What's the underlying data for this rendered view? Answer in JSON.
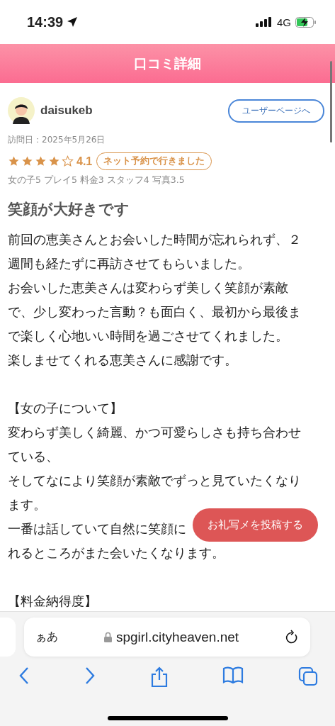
{
  "status_bar": {
    "time": "14:39",
    "network": "4G"
  },
  "header": {
    "title": "口コミ詳細"
  },
  "review": {
    "user": {
      "name": "daisukeb",
      "profile_button": "ユーザーページへ"
    },
    "visit_date": "訪問日：2025年5月26日",
    "stars": 4,
    "score": "4.1",
    "badge": "ネット予約で行きました",
    "sub_ratings": "女の子5 プレイ5 料金3 スタッフ4 写真3.5",
    "title": "笑顔が大好きです",
    "paragraphs": [
      {
        "lines": [
          "前回の恵美さんとお会いした時間が忘れられず、２",
          "週間も経たずに再訪させてもらいました。",
          "お会いした恵美さんは変わらず美しく笑顔が素敵",
          "で、少し変わった言動？も面白く、最初から最後ま",
          "で楽しく心地いい時間を過ごさせてくれました。",
          "楽しませてくれる恵美さんに感謝です。"
        ]
      },
      {
        "lines": [
          "【女の子について】",
          "変わらず美しく綺麗、かつ可愛らしさも持ち合わせ",
          "ている、",
          "そしてなにより笑顔が素敵でずっと見ていたくなり",
          "ます。",
          "一番は話していて自然に笑顔に",
          "れるところがまた会いたくなります。"
        ]
      },
      {
        "lines": [
          "【料金納得度】"
        ]
      }
    ]
  },
  "floating_button": "お礼写メを投稿する",
  "browser": {
    "text_size": "ぁあ",
    "url": "spgirl.cityheaven.net"
  }
}
